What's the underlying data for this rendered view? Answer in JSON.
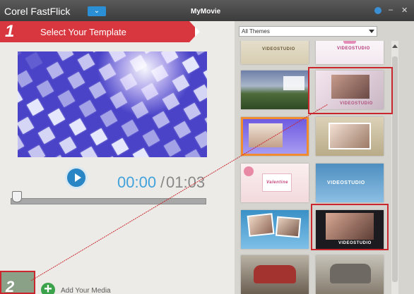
{
  "window": {
    "app_name": "Corel FastFlick",
    "document_title": "MyMovie",
    "menu_glyph": "⌄",
    "minimize_glyph": "–",
    "close_glyph": "✕"
  },
  "step1": {
    "number": "1",
    "label": "Select Your Template"
  },
  "player": {
    "current_time": "00:00",
    "separator": "/",
    "total_time": "01:03",
    "playhead_progress": 0
  },
  "step2": {
    "number": "2",
    "add_media_label": "Add Your Media"
  },
  "templates": {
    "filter_value": "All Themes",
    "items": [
      {
        "name": "template-videostudio-beige",
        "caption": "VIDEOSTUDIO"
      },
      {
        "name": "template-wedding-pink",
        "caption": "VIDEOSTUDIO"
      },
      {
        "name": "template-landscape",
        "caption": ""
      },
      {
        "name": "template-couple-pink",
        "caption": "VIDEOSTUDIO"
      },
      {
        "name": "template-purple-friends",
        "caption": ""
      },
      {
        "name": "template-family-frame",
        "caption": ""
      },
      {
        "name": "template-valentine",
        "caption": "Valentine"
      },
      {
        "name": "template-videostudio-blue",
        "caption": "VIDEOSTUDIO"
      },
      {
        "name": "template-photo-frames-blue",
        "caption": ""
      },
      {
        "name": "template-couple-dark",
        "caption": "VIDEOSTUDIO"
      },
      {
        "name": "template-classic-car",
        "caption": ""
      },
      {
        "name": "template-vintage-car",
        "caption": ""
      }
    ]
  },
  "colors": {
    "accent_red": "#d9373f",
    "accent_blue": "#41a2db",
    "selection_orange": "#f08c2e",
    "callout_red": "#c9262e"
  }
}
